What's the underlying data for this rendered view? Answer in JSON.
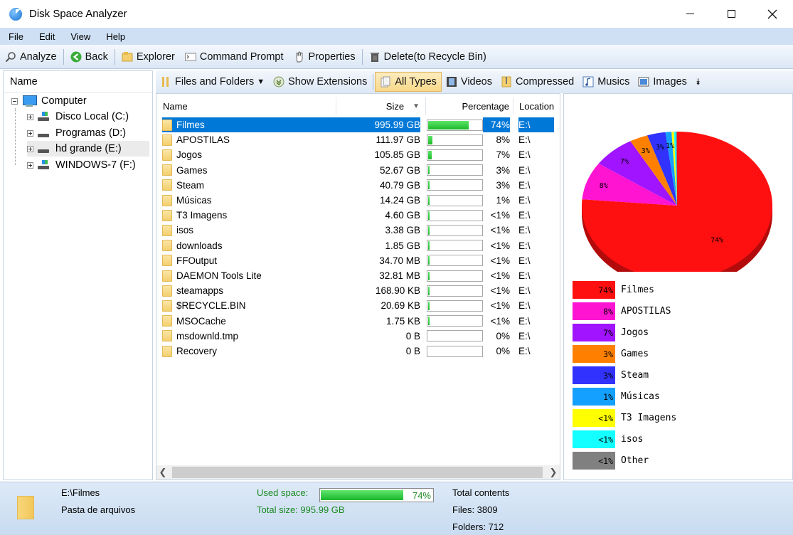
{
  "window": {
    "title": "Disk Space Analyzer"
  },
  "menu": [
    "File",
    "Edit",
    "View",
    "Help"
  ],
  "toolbar": {
    "analyze": "Analyze",
    "back": "Back",
    "explorer": "Explorer",
    "cmd": "Command Prompt",
    "properties": "Properties",
    "delete": "Delete(to Recycle Bin)"
  },
  "tree": {
    "header": "Name",
    "root": "Computer",
    "drives": [
      {
        "label": "Disco Local (C:)"
      },
      {
        "label": "Programas (D:)"
      },
      {
        "label": "hd grande (E:)"
      },
      {
        "label": "WINDOWS-7 (F:)"
      }
    ]
  },
  "filter_toolbar": {
    "files_folders": "Files and Folders",
    "show_ext": "Show Extensions",
    "all_types": "All Types",
    "videos": "Videos",
    "compressed": "Compressed",
    "musics": "Musics",
    "images": "Images"
  },
  "list": {
    "columns": {
      "name": "Name",
      "size": "Size",
      "percentage": "Percentage",
      "location": "Location"
    },
    "rows": [
      {
        "name": "Filmes",
        "size": "995.99 GB",
        "pct": "74%",
        "fill": 0.74,
        "loc": "E:\\"
      },
      {
        "name": "APOSTILAS",
        "size": "111.97 GB",
        "pct": "8%",
        "fill": 0.08,
        "loc": "E:\\"
      },
      {
        "name": "Jogos",
        "size": "105.85 GB",
        "pct": "7%",
        "fill": 0.07,
        "loc": "E:\\"
      },
      {
        "name": "Games",
        "size": "52.67 GB",
        "pct": "3%",
        "fill": 0.03,
        "loc": "E:\\"
      },
      {
        "name": "Steam",
        "size": "40.79 GB",
        "pct": "3%",
        "fill": 0.03,
        "loc": "E:\\"
      },
      {
        "name": "Músicas",
        "size": "14.24 GB",
        "pct": "1%",
        "fill": 0.01,
        "loc": "E:\\"
      },
      {
        "name": "T3 Imagens",
        "size": "4.60 GB",
        "pct": "<1%",
        "fill": 0.005,
        "loc": "E:\\"
      },
      {
        "name": "isos",
        "size": "3.38 GB",
        "pct": "<1%",
        "fill": 0.005,
        "loc": "E:\\"
      },
      {
        "name": "downloads",
        "size": "1.85 GB",
        "pct": "<1%",
        "fill": 0.005,
        "loc": "E:\\"
      },
      {
        "name": "FFOutput",
        "size": "34.70 MB",
        "pct": "<1%",
        "fill": 0.005,
        "loc": "E:\\"
      },
      {
        "name": "DAEMON Tools Lite",
        "size": "32.81 MB",
        "pct": "<1%",
        "fill": 0.005,
        "loc": "E:\\"
      },
      {
        "name": "steamapps",
        "size": "168.90 KB",
        "pct": "<1%",
        "fill": 0.005,
        "loc": "E:\\"
      },
      {
        "name": "$RECYCLE.BIN",
        "size": "20.69 KB",
        "pct": "<1%",
        "fill": 0.005,
        "loc": "E:\\"
      },
      {
        "name": "MSOCache",
        "size": "1.75 KB",
        "pct": "<1%",
        "fill": 0.005,
        "loc": "E:\\"
      },
      {
        "name": "msdownld.tmp",
        "size": "0 B",
        "pct": "0%",
        "fill": 0,
        "loc": "E:\\"
      },
      {
        "name": "Recovery",
        "size": "0 B",
        "pct": "0%",
        "fill": 0,
        "loc": "E:\\"
      }
    ]
  },
  "chart_data": {
    "type": "pie",
    "slices": [
      {
        "name": "Filmes",
        "value": 74,
        "label": "74%",
        "color": "#ff1010"
      },
      {
        "name": "APOSTILAS",
        "value": 8,
        "label": "8%",
        "color": "#ff14d2"
      },
      {
        "name": "Jogos",
        "value": 7,
        "label": "7%",
        "color": "#a014ff"
      },
      {
        "name": "Games",
        "value": 3,
        "label": "3%",
        "color": "#ff8000"
      },
      {
        "name": "Steam",
        "value": 3,
        "label": "3%",
        "color": "#3232ff"
      },
      {
        "name": "Músicas",
        "value": 1,
        "label": "1%",
        "color": "#14a0ff"
      },
      {
        "name": "T3 Imagens",
        "value": 0.4,
        "label": "<1%",
        "color": "#ffff00"
      },
      {
        "name": "isos",
        "value": 0.3,
        "label": "<1%",
        "color": "#14ffff"
      },
      {
        "name": "Other",
        "value": 0.2,
        "label": "<1%",
        "color": "#808080"
      }
    ]
  },
  "status": {
    "path": "E:\\Filmes",
    "type": "Pasta de arquivos",
    "used_label": "Used space:",
    "used_pct": "74%",
    "used_fill": 0.74,
    "total_size": "Total size: 995.99 GB",
    "total_contents": "Total contents",
    "files": "Files: 3809",
    "folders": "Folders: 712"
  },
  "colors": {
    "selection": "#0078d7",
    "bar_green": "#1bb82a",
    "menubar": "#cfe0f5"
  }
}
